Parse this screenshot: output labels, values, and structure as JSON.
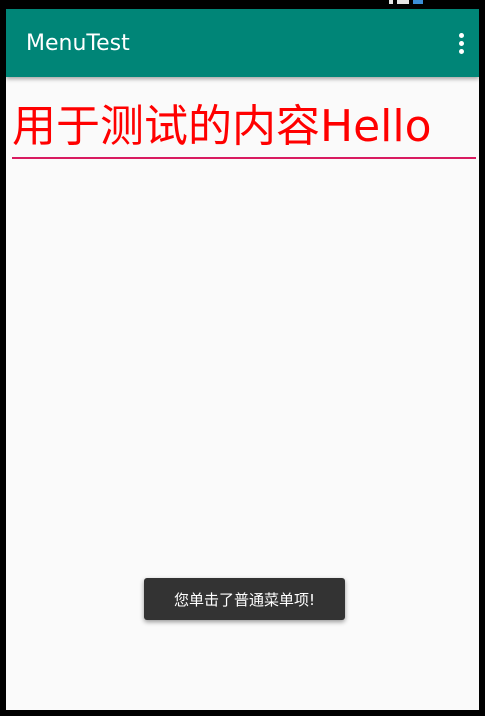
{
  "app_bar": {
    "title": "MenuTest",
    "overflow_icon": "more-vert-icon",
    "color": "#008577"
  },
  "content": {
    "text": "用于测试的内容Hello",
    "text_color": "#ff0000",
    "underline_color": "#d81b60"
  },
  "toast": {
    "message": "您单击了普通菜单项!"
  }
}
